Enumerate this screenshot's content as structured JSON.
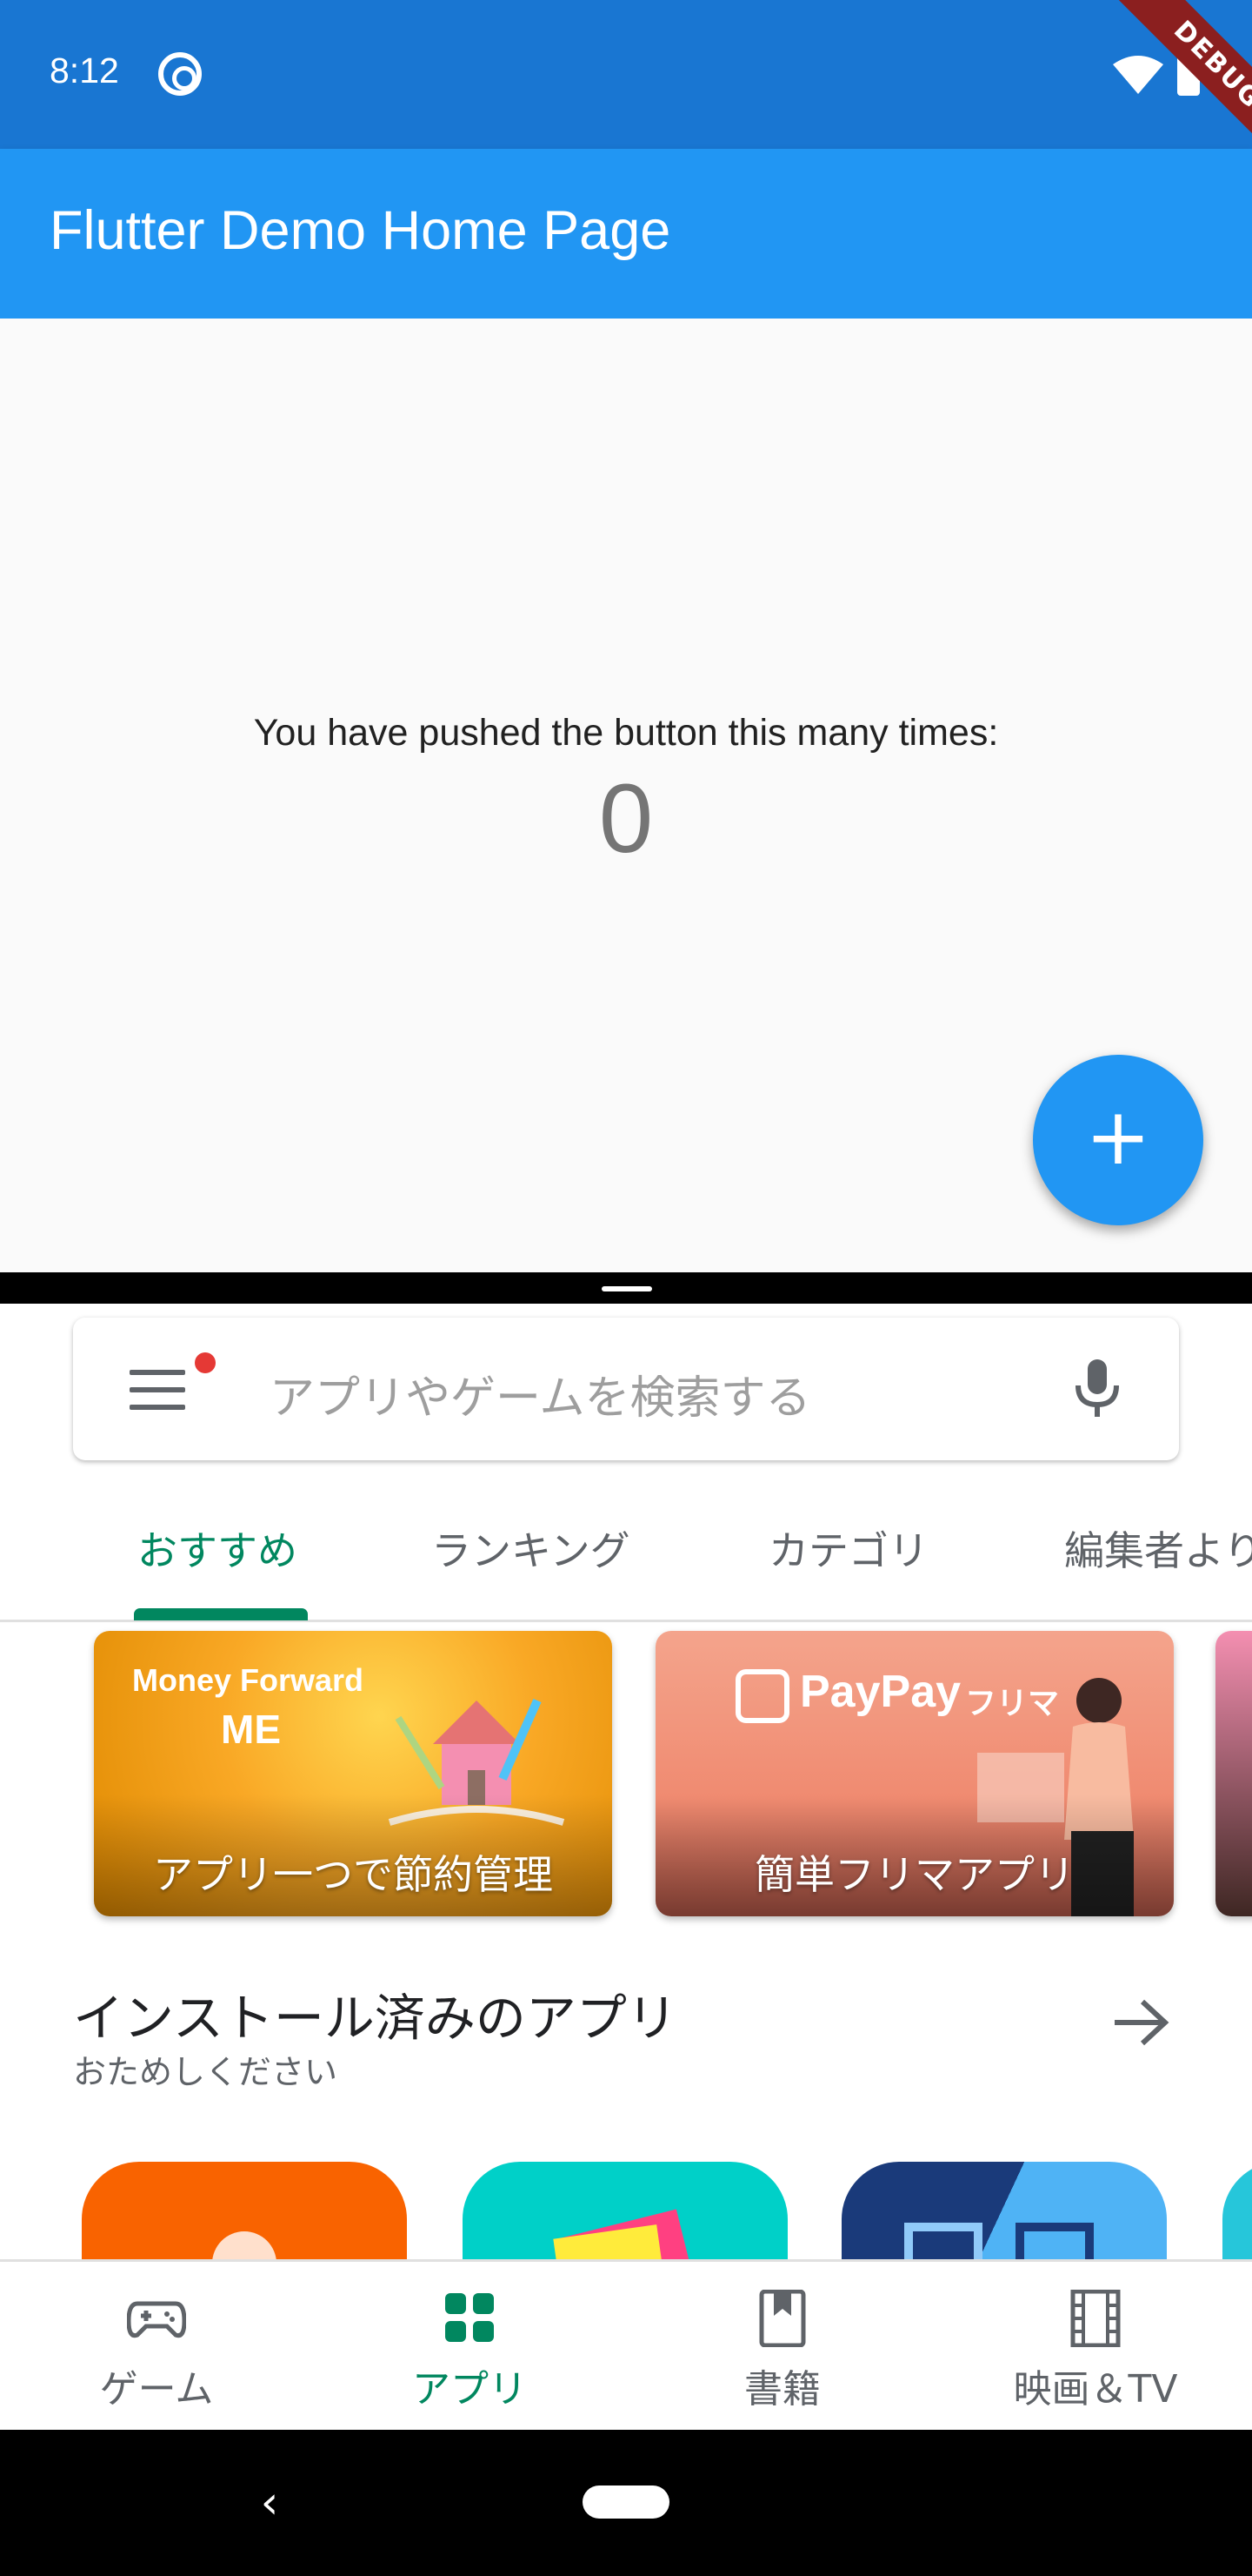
{
  "status_bar": {
    "time": "8:12",
    "debug_label": "DEBUG"
  },
  "flutter_app": {
    "title": "Flutter Demo Home Page",
    "counter_label": "You have pushed the button this many times:",
    "counter_value": "0",
    "fab_label": "+"
  },
  "store": {
    "search": {
      "placeholder": "アプリやゲームを検索する"
    },
    "tabs": [
      {
        "label": "おすすめ",
        "active": true
      },
      {
        "label": "ランキング",
        "active": false
      },
      {
        "label": "カテゴリ",
        "active": false
      },
      {
        "label": "編集者より",
        "active": false
      }
    ],
    "promos": [
      {
        "brand": "Money Forward",
        "brand_sub": "ME",
        "caption": "アプリ一つで節約管理"
      },
      {
        "brand": "PayPay",
        "brand_sub": "フリマ",
        "caption": "簡単フリマアプリ"
      }
    ],
    "section": {
      "title": "インストール済みのアプリ",
      "subtitle": "おためしください"
    },
    "bottom_nav": [
      {
        "label": "ゲーム",
        "icon": "gamepad-icon",
        "active": false
      },
      {
        "label": "アプリ",
        "icon": "apps-grid-icon",
        "active": true
      },
      {
        "label": "書籍",
        "icon": "book-icon",
        "active": false
      },
      {
        "label": "映画＆TV",
        "icon": "film-icon",
        "active": false
      }
    ]
  },
  "colors": {
    "status_bar": "#1976D2",
    "app_bar": "#2196F3",
    "accent_green": "#01875f"
  }
}
